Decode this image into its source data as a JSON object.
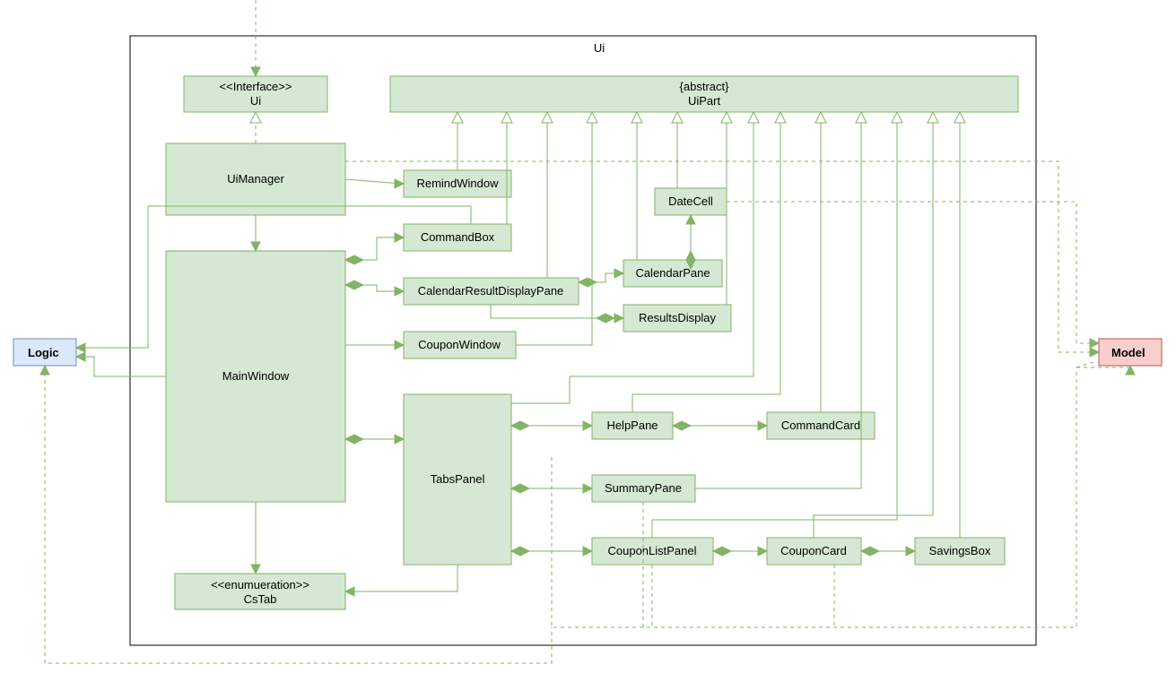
{
  "package_title": "Ui",
  "nodes": {
    "logic": "Logic",
    "model": "Model",
    "ui_interface_stereo": "<<Interface>>",
    "ui_interface_name": "Ui",
    "uipart_stereo": "{abstract}",
    "uipart_name": "UiPart",
    "uimanager": "UiManager",
    "mainwindow": "MainWindow",
    "remindwindow": "RemindWindow",
    "commandbox": "CommandBox",
    "calendarresultdisplaypane": "CalendarResultDisplayPane",
    "couponwindow": "CouponWindow",
    "tabspanel": "TabsPanel",
    "datecell": "DateCell",
    "calendarpane": "CalendarPane",
    "resultsdisplay": "ResultsDisplay",
    "helppane": "HelpPane",
    "commandcard": "CommandCard",
    "summarypane": "SummaryPane",
    "couponlistpanel": "CouponListPanel",
    "couponcard": "CouponCard",
    "savingsbox": "SavingsBox",
    "cstab_stereo": "<<enumueration>>",
    "cstab_name": "CsTab"
  }
}
